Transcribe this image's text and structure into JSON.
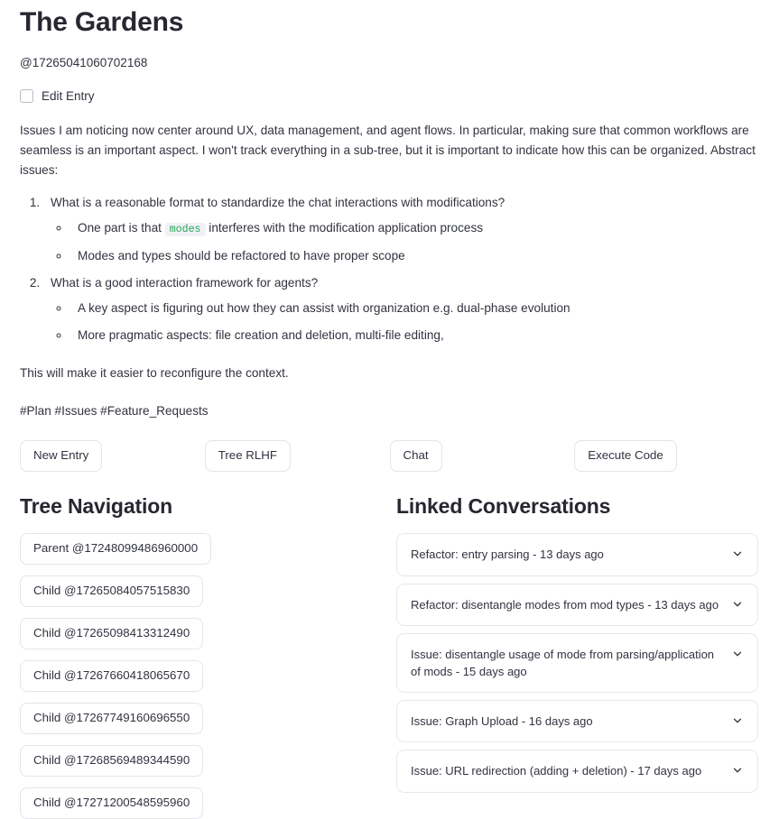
{
  "header": {
    "title": "The Gardens",
    "entry_id": "@17265041060702168"
  },
  "edit_toggle": {
    "label": "Edit Entry",
    "checked": false
  },
  "content": {
    "intro": "Issues I am noticing now center around UX, data management, and agent flows. In particular, making sure that common workflows are seamless is an important aspect. I won't track everything in a sub-tree, but it is important to indicate how this can be organized. Abstract issues:",
    "items": [
      {
        "text": "What is a reasonable format to standardize the chat interactions with modifications?",
        "sub": [
          {
            "pre": "One part is that ",
            "code": "modes",
            "post": " interferes with the modification application process"
          },
          {
            "pre": "Modes and types should be refactored to have proper scope",
            "code": "",
            "post": ""
          }
        ]
      },
      {
        "text": "What is a good interaction framework for agents?",
        "sub": [
          {
            "pre": "A key aspect is figuring out how they can assist with organization e.g. dual-phase evolution",
            "code": "",
            "post": ""
          },
          {
            "pre": "More pragmatic aspects: file creation and deletion, multi-file editing,",
            "code": "",
            "post": ""
          }
        ]
      }
    ],
    "closing": "This will make it easier to reconfigure the context.",
    "tags": "#Plan #Issues #Feature_Requests"
  },
  "actions": [
    {
      "label": "New Entry"
    },
    {
      "label": "Tree RLHF"
    },
    {
      "label": "Chat"
    },
    {
      "label": "Execute Code"
    }
  ],
  "tree_navigation": {
    "title": "Tree Navigation",
    "nodes": [
      {
        "label": "Parent @17248099486960000"
      },
      {
        "label": "Child @17265084057515830"
      },
      {
        "label": "Child @17265098413312490"
      },
      {
        "label": "Child @17267660418065670"
      },
      {
        "label": "Child @17267749160696550"
      },
      {
        "label": "Child @17268569489344590"
      },
      {
        "label": "Child @17271200548595960"
      }
    ]
  },
  "linked_conversations": {
    "title": "Linked Conversations",
    "items": [
      {
        "label": "Refactor: entry parsing - 13 days ago"
      },
      {
        "label": "Refactor: disentangle modes from mod types - 13 days ago"
      },
      {
        "label": "Issue: disentangle usage of mode from parsing/application of mods - 15 days ago"
      },
      {
        "label": "Issue: Graph Upload - 16 days ago"
      },
      {
        "label": "Issue: URL redirection (adding + deletion) - 17 days ago"
      }
    ]
  },
  "colors": {
    "text": "#31333F",
    "heading": "#262730",
    "border": "#e3e5ea",
    "code_text": "#2aa35a",
    "code_bg": "#f0f2f6",
    "accent": "#ff4b4b"
  },
  "icons": {
    "chevron": "chevron-down-icon"
  }
}
